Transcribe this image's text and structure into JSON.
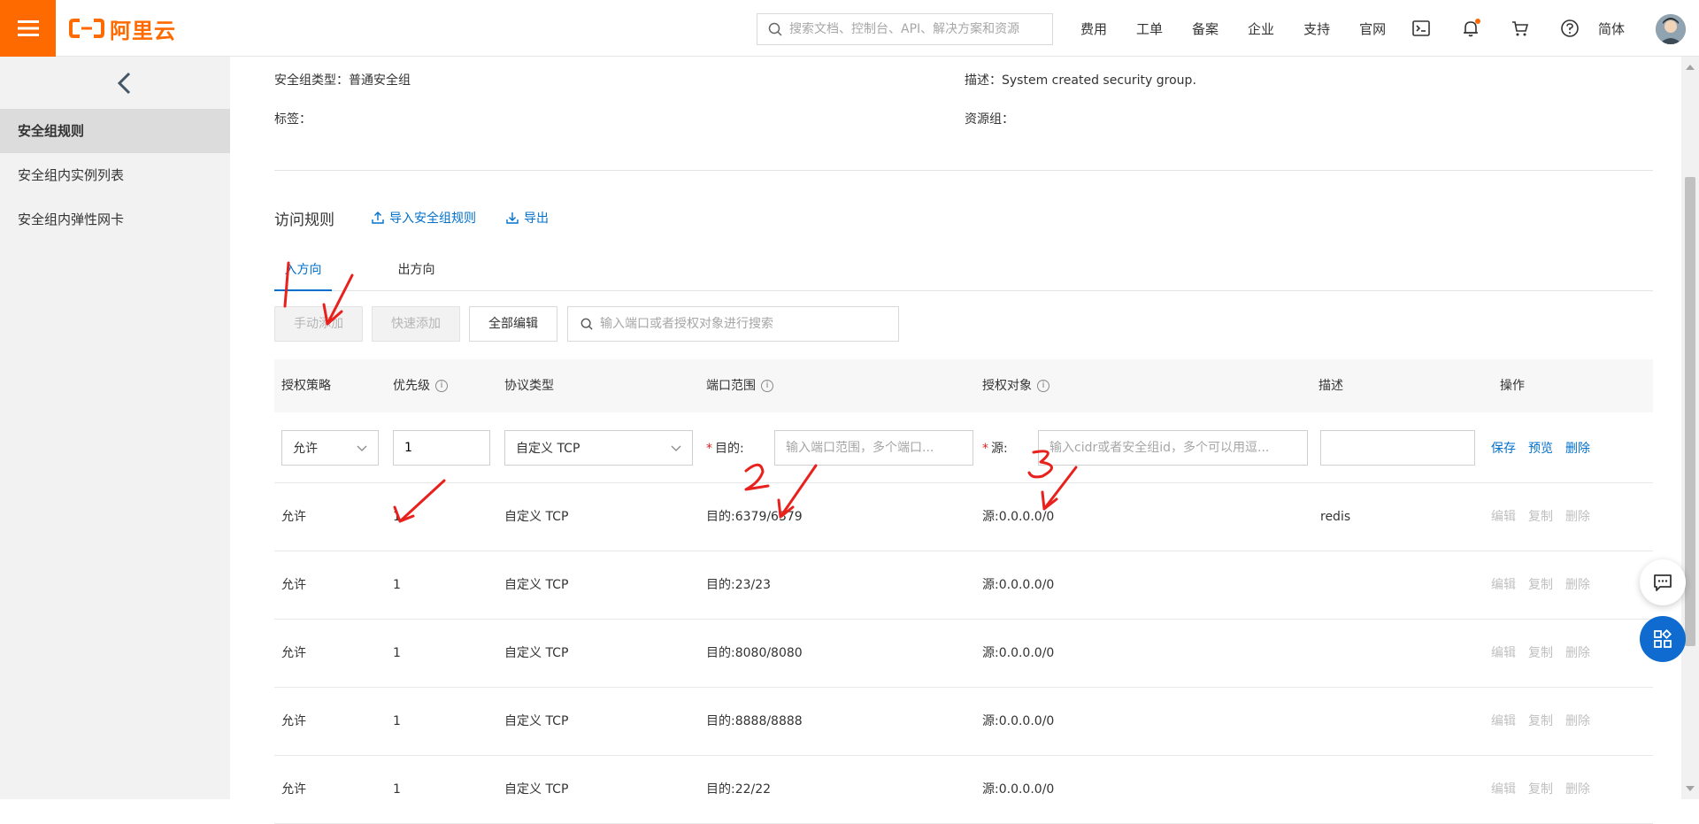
{
  "topbar": {
    "brand": "阿里云",
    "search_placeholder": "搜索文档、控制台、API、解决方案和资源",
    "nav": [
      "费用",
      "工单",
      "备案",
      "企业",
      "支持",
      "官网"
    ],
    "icons": [
      "terminal-icon",
      "bell-icon",
      "cart-icon",
      "help-icon"
    ],
    "lang": "简体"
  },
  "sidebar": {
    "items": [
      {
        "label": "安全组规则",
        "active": true
      },
      {
        "label": "安全组内实例列表",
        "active": false
      },
      {
        "label": "安全组内弹性网卡",
        "active": false
      }
    ]
  },
  "info": {
    "type_label": "安全组类型：",
    "type_value": "普通安全组",
    "tags_label": "标签：",
    "desc_label": "描述：",
    "desc_value": "System created security group.",
    "rg_label": "资源组："
  },
  "rules": {
    "title": "访问规则",
    "import_label": "导入安全组规则",
    "export_label": "导出",
    "tabs": [
      "入方向",
      "出方向"
    ],
    "toolbar": {
      "manual_add": "手动添加",
      "quick_add": "快速添加",
      "edit_all": "全部编辑",
      "search_placeholder": "输入端口或者授权对象进行搜索"
    },
    "columns": [
      "授权策略",
      "优先级",
      "协议类型",
      "端口范围",
      "授权对象",
      "描述",
      "操作"
    ],
    "edit_row": {
      "policy": "允许",
      "priority": "1",
      "protocol": "自定义 TCP",
      "dest_label": "目的:",
      "port_placeholder": "输入端口范围，多个端口...",
      "source_label": "源:",
      "source_placeholder": "输入cidr或者安全组id，多个可以用逗...",
      "description": "",
      "save": "保存",
      "preview": "预览",
      "delete": "删除"
    },
    "row_actions": [
      "编辑",
      "复制",
      "删除"
    ],
    "rows": [
      {
        "policy": "允许",
        "priority": "1",
        "protocol": "自定义 TCP",
        "port": "目的:6379/6379",
        "source": "源:0.0.0.0/0",
        "desc": "redis"
      },
      {
        "policy": "允许",
        "priority": "1",
        "protocol": "自定义 TCP",
        "port": "目的:23/23",
        "source": "源:0.0.0.0/0",
        "desc": ""
      },
      {
        "policy": "允许",
        "priority": "1",
        "protocol": "自定义 TCP",
        "port": "目的:8080/8080",
        "source": "源:0.0.0.0/0",
        "desc": ""
      },
      {
        "policy": "允许",
        "priority": "1",
        "protocol": "自定义 TCP",
        "port": "目的:8888/8888",
        "source": "源:0.0.0.0/0",
        "desc": ""
      },
      {
        "policy": "允许",
        "priority": "1",
        "protocol": "自定义 TCP",
        "port": "目的:22/22",
        "source": "源:0.0.0.0/0",
        "desc": ""
      }
    ]
  },
  "annotations": [
    "1",
    "2",
    "3"
  ],
  "colors": {
    "brand": "#ff6a00",
    "link": "#0070cc",
    "annotation": "#e8211d"
  }
}
